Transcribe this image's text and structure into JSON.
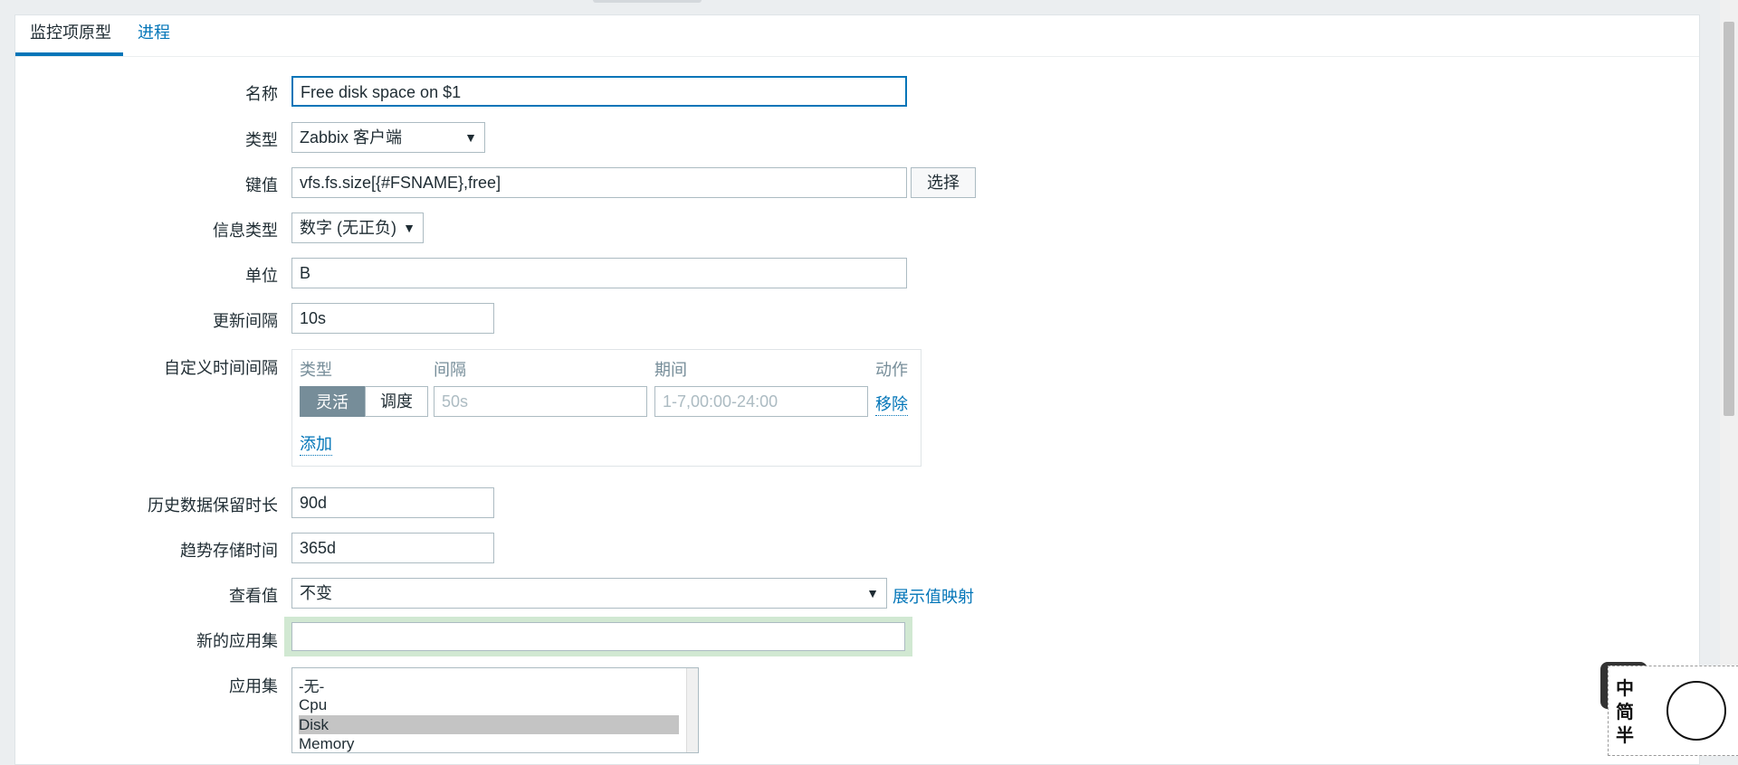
{
  "tabs": [
    {
      "label": "监控项原型"
    },
    {
      "label": "进程"
    }
  ],
  "form": {
    "name": {
      "label": "名称",
      "value": "Free disk space on $1"
    },
    "type": {
      "label": "类型",
      "value": "Zabbix 客户端"
    },
    "key": {
      "label": "键值",
      "value": "vfs.fs.size[{#FSNAME},free]",
      "select_button": "选择"
    },
    "info_type": {
      "label": "信息类型",
      "value": "数字 (无正负)"
    },
    "units": {
      "label": "单位",
      "value": "B"
    },
    "update_interval": {
      "label": "更新间隔",
      "value": "10s"
    },
    "custom_intervals": {
      "label": "自定义时间间隔",
      "headers": {
        "type": "类型",
        "interval": "间隔",
        "period": "期间",
        "action": "动作"
      },
      "row": {
        "flexible": "灵活",
        "scheduling": "调度",
        "interval_placeholder": "50s",
        "period_placeholder": "1-7,00:00-24:00",
        "remove": "移除"
      },
      "add": "添加"
    },
    "history": {
      "label": "历史数据保留时长",
      "value": "90d"
    },
    "trends": {
      "label": "趋势存储时间",
      "value": "365d"
    },
    "show_value": {
      "label": "查看值",
      "value": "不变",
      "link": "展示值映射"
    },
    "new_application": {
      "label": "新的应用集",
      "value": ""
    },
    "applications": {
      "label": "应用集",
      "options": [
        "-无-",
        "Cpu",
        "Disk",
        "Memory"
      ],
      "selected": "Disk"
    }
  },
  "ime": {
    "chars": [
      "中",
      "简",
      "半"
    ]
  },
  "icons": {
    "dropdown": "chevron-down-icon"
  },
  "colors": {
    "accent": "#0275b8",
    "selected_segment": "#768d99",
    "highlight": "#d1e8d2"
  }
}
